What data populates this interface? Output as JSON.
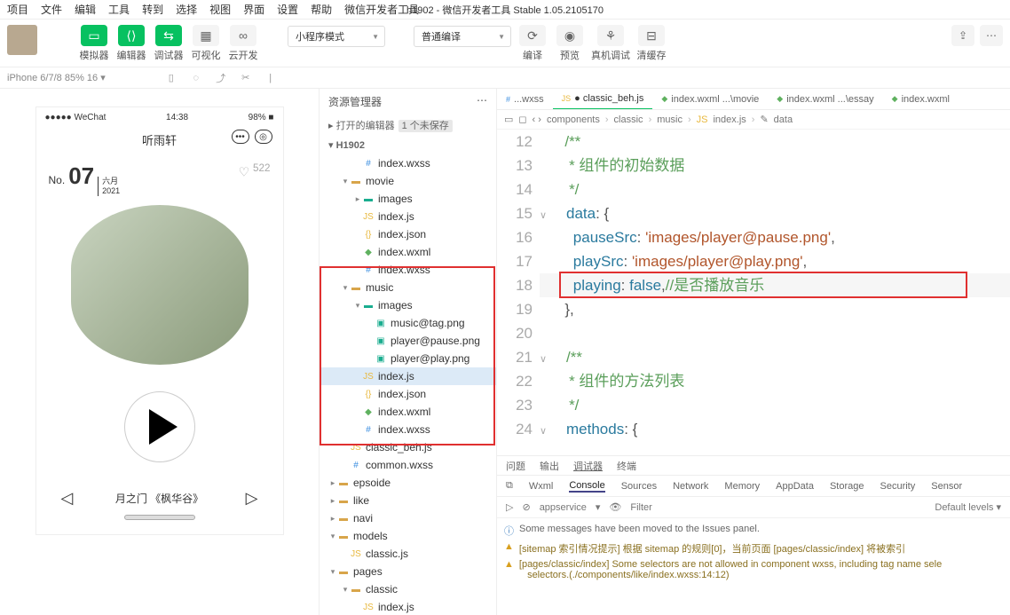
{
  "menu": [
    "项目",
    "文件",
    "编辑",
    "工具",
    "转到",
    "选择",
    "视图",
    "界面",
    "设置",
    "帮助",
    "微信开发者工具"
  ],
  "title_center": "h1902 - 微信开发者工具 Stable 1.05.2105170",
  "toolbar": {
    "simulator": "模拟器",
    "editor": "编辑器",
    "debugger": "调试器",
    "visual": "可视化",
    "clouddev": "云开发",
    "mode": "小程序模式",
    "compile": "普通编译",
    "compile_btn": "编译",
    "preview": "预览",
    "realdbg": "真机调试",
    "cache": "清缓存"
  },
  "subbar": {
    "device": "iPhone 6/7/8 85% 16 ▾"
  },
  "phone": {
    "carrier": "●●●●● WeChat",
    "time": "14:38",
    "battery": "98% ■",
    "title": "听雨轩",
    "no_prefix": "No.",
    "no": "07",
    "month": "六月",
    "year": "2021",
    "heart_count": "522",
    "track": "月之门 《枫华谷》"
  },
  "explorer": {
    "title": "资源管理器",
    "opened": "打开的编辑器",
    "unsaved": "1 个未保存",
    "project": "H1902",
    "tree": [
      {
        "d": 2,
        "t": "index.wxss",
        "i": "wxss"
      },
      {
        "d": 1,
        "t": "movie",
        "i": "folder",
        "tw": "▾"
      },
      {
        "d": 2,
        "t": "images",
        "i": "folder-teal",
        "tw": "▸"
      },
      {
        "d": 2,
        "t": "index.js",
        "i": "js"
      },
      {
        "d": 2,
        "t": "index.json",
        "i": "json"
      },
      {
        "d": 2,
        "t": "index.wxml",
        "i": "wxml"
      },
      {
        "d": 2,
        "t": "index.wxss",
        "i": "wxss"
      },
      {
        "d": 1,
        "t": "music",
        "i": "folder",
        "tw": "▾"
      },
      {
        "d": 2,
        "t": "images",
        "i": "folder-teal",
        "tw": "▾"
      },
      {
        "d": 3,
        "t": "music@tag.png",
        "i": "img"
      },
      {
        "d": 3,
        "t": "player@pause.png",
        "i": "img"
      },
      {
        "d": 3,
        "t": "player@play.png",
        "i": "img"
      },
      {
        "d": 2,
        "t": "index.js",
        "i": "js",
        "sel": true
      },
      {
        "d": 2,
        "t": "index.json",
        "i": "json"
      },
      {
        "d": 2,
        "t": "index.wxml",
        "i": "wxml"
      },
      {
        "d": 2,
        "t": "index.wxss",
        "i": "wxss"
      },
      {
        "d": 1,
        "t": "classic_beh.js",
        "i": "js"
      },
      {
        "d": 1,
        "t": "common.wxss",
        "i": "wxss"
      },
      {
        "d": 0,
        "t": "epsoide",
        "i": "folder",
        "tw": "▸"
      },
      {
        "d": 0,
        "t": "like",
        "i": "folder",
        "tw": "▸"
      },
      {
        "d": 0,
        "t": "navi",
        "i": "folder",
        "tw": "▸"
      },
      {
        "d": 0,
        "t": "models",
        "i": "folder",
        "tw": "▾",
        "yellow": true
      },
      {
        "d": 1,
        "t": "classic.js",
        "i": "js"
      },
      {
        "d": 0,
        "t": "pages",
        "i": "folder",
        "tw": "▾",
        "yellow": true
      },
      {
        "d": 1,
        "t": "classic",
        "i": "folder",
        "tw": "▾"
      },
      {
        "d": 2,
        "t": "index.js",
        "i": "js"
      }
    ]
  },
  "tabs": [
    {
      "label": "...wxss",
      "icon": "wxss"
    },
    {
      "label": "classic_beh.js",
      "icon": "js",
      "active": true,
      "dirty": true
    },
    {
      "label": "index.wxml ...\\movie",
      "icon": "wxml"
    },
    {
      "label": "index.wxml ...\\essay",
      "icon": "wxml"
    },
    {
      "label": "index.wxml",
      "icon": "wxml"
    }
  ],
  "breadcrumbs": [
    "components",
    "classic",
    "music",
    "index.js",
    "data"
  ],
  "code": {
    "start": 12,
    "lines": [
      {
        "html": "    <span class='c-comment'>/**</span>"
      },
      {
        "html": "    <span class='c-comment'> * 组件的初始数据</span>"
      },
      {
        "html": "    <span class='c-comment'> */</span>"
      },
      {
        "html": "    <span class='c-key'>data</span><span class='c-punct'>: {</span>",
        "fold": "∨"
      },
      {
        "html": "      <span class='c-key'>pauseSrc</span><span class='c-punct'>: </span><span class='c-str'>'images/player@pause.png'</span><span class='c-punct'>,</span>"
      },
      {
        "html": "      <span class='c-key'>playSrc</span><span class='c-punct'>: </span><span class='c-str'>'images/player@play.png'</span><span class='c-punct'>,</span>"
      },
      {
        "html": "      <span class='c-key'>playing</span><span class='c-punct'>: </span><span class='c-bool'>false</span><span class='c-punct'>,</span><span class='c-comment'>//是否播放音乐</span>",
        "hl": true
      },
      {
        "html": "    <span class='c-punct'>},</span>"
      },
      {
        "html": ""
      },
      {
        "html": "    <span class='c-comment'>/**</span>",
        "fold": "∨"
      },
      {
        "html": "    <span class='c-comment'> * 组件的方法列表</span>"
      },
      {
        "html": "    <span class='c-comment'> */</span>"
      },
      {
        "html": "    <span class='c-key'>methods</span><span class='c-punct'>: {</span>",
        "fold": "∨"
      }
    ]
  },
  "bottom": {
    "tabs1": [
      "问题",
      "输出",
      "调试器",
      "终端"
    ],
    "tabs2": [
      "Wxml",
      "Console",
      "Sources",
      "Network",
      "Memory",
      "AppData",
      "Storage",
      "Security",
      "Sensor"
    ],
    "service": "appservice",
    "filter_ph": "Filter",
    "levels": "Default levels ▾",
    "msg1": "Some messages have been moved to the Issues panel.",
    "msg2": "[sitemap 索引情况提示] 根据 sitemap 的规则[0]，当前页面 [pages/classic/index] 将被索引",
    "msg3a": "[pages/classic/index] Some selectors are not allowed in component wxss, including tag name sele",
    "msg3b": "selectors.(./components/like/index.wxss:14:12)"
  }
}
